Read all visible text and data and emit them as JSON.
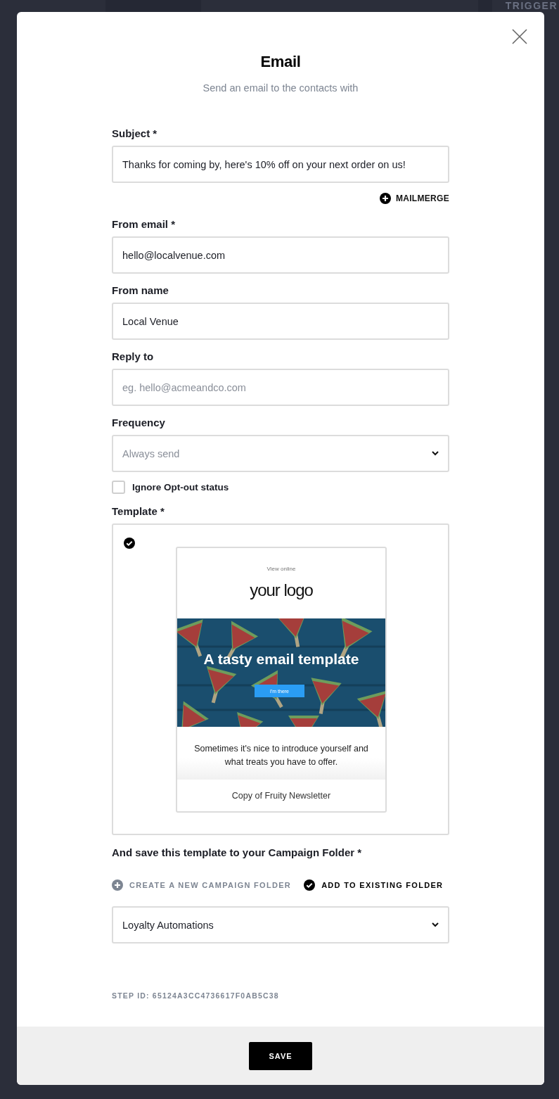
{
  "background": {
    "label": "TRIGGER"
  },
  "dialog": {
    "title": "Email",
    "subtitle": "Send an email to the contacts with"
  },
  "fields": [
    {
      "kind": "input",
      "label": "Subject *",
      "value": "Thanks for coming by, here's 10% off on your next order on us!"
    },
    {
      "kind": "link",
      "label": "MAILMERGE"
    },
    {
      "kind": "input",
      "label": "From email *",
      "value": "hello@localvenue.com"
    },
    {
      "kind": "input",
      "label": "From name",
      "value": "Local Venue"
    },
    {
      "kind": "input",
      "label": "Reply to",
      "placeholder": "eg. hello@acmeandco.com"
    },
    {
      "kind": "select",
      "label": "Frequency",
      "placeholder": "Always send"
    },
    {
      "kind": "checkbox",
      "label": "Ignore Opt-out status",
      "checked": false
    }
  ],
  "template": {
    "label": "Template *",
    "selected": true,
    "preview": {
      "view_online": "View online",
      "logo": "your logo",
      "headline": "A tasty email template",
      "button": "I'm there",
      "body": "Sometimes it's nice to introduce yourself and what treats you have to offer.",
      "name": "Copy of Fruity Newsletter"
    }
  },
  "folder": {
    "label": "And save this template to your Campaign Folder *",
    "options": [
      {
        "label": "CREATE A NEW CAMPAIGN FOLDER",
        "selected": false
      },
      {
        "label": "ADD TO EXISTING FOLDER",
        "selected": true
      }
    ],
    "value": "Loyalty Automations"
  },
  "step_id": "STEP ID: 65124A3CC4736617F0AB5C38",
  "footer": {
    "button": "SAVE"
  }
}
